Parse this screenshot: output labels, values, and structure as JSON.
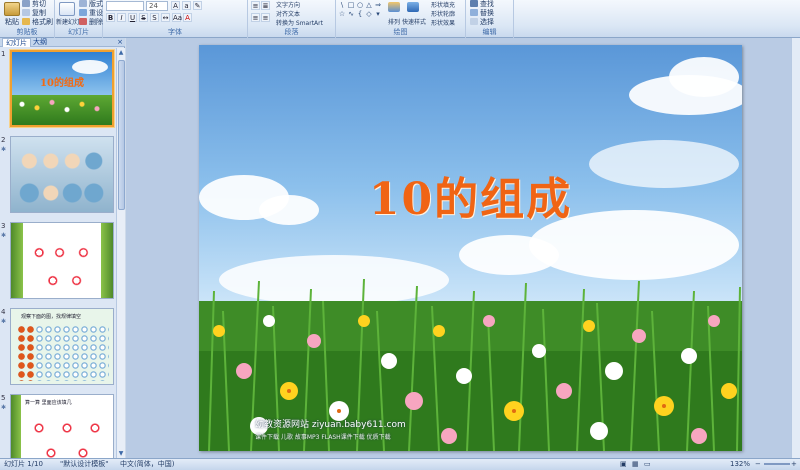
{
  "ribbon": {
    "groups": [
      {
        "label": "剪贴板",
        "buttons": [
          "粘贴",
          "剪切",
          "复制",
          "格式刷"
        ]
      },
      {
        "label": "幻灯片",
        "buttons": [
          "新建幻灯片",
          "版式",
          "重设",
          "删除"
        ]
      },
      {
        "label": "字体",
        "font_size": "24"
      },
      {
        "label": "段落",
        "buttons": [
          "文字方向",
          "对齐文本",
          "转换为 SmartArt"
        ]
      },
      {
        "label": "绘图",
        "buttons": [
          "排列",
          "快速样式",
          "形状填充",
          "形状轮廓",
          "形状效果"
        ]
      },
      {
        "label": "编辑",
        "buttons": [
          "查找",
          "替换",
          "选择"
        ]
      }
    ]
  },
  "left_panel": {
    "tabs": [
      "幻灯片",
      "大纲"
    ],
    "close_glyph": "×",
    "thumbnails": [
      {
        "num": "1",
        "title": "10的组成"
      },
      {
        "num": "2"
      },
      {
        "num": "3"
      },
      {
        "num": "4",
        "caption": "观察下面的图，找规律填空"
      },
      {
        "num": "5",
        "caption": "算一算 里面应该填几"
      }
    ]
  },
  "slide": {
    "title": "10的组成",
    "watermark_main": "幼教资源网站 ziyuan.baby611.com",
    "watermark_sub": "课件下载  儿歌  故事MP3  FLASH课件下载  优质下载"
  },
  "status": {
    "slide_info": "幻灯片 1/10",
    "theme": "\"默认设计模板\"",
    "language": "中文(简体，中国)",
    "zoom": "132%"
  },
  "colors": {
    "title_orange": "#f06414",
    "ribbon_blue": "#dbe7f5",
    "selection_orange": "#f0a030"
  }
}
